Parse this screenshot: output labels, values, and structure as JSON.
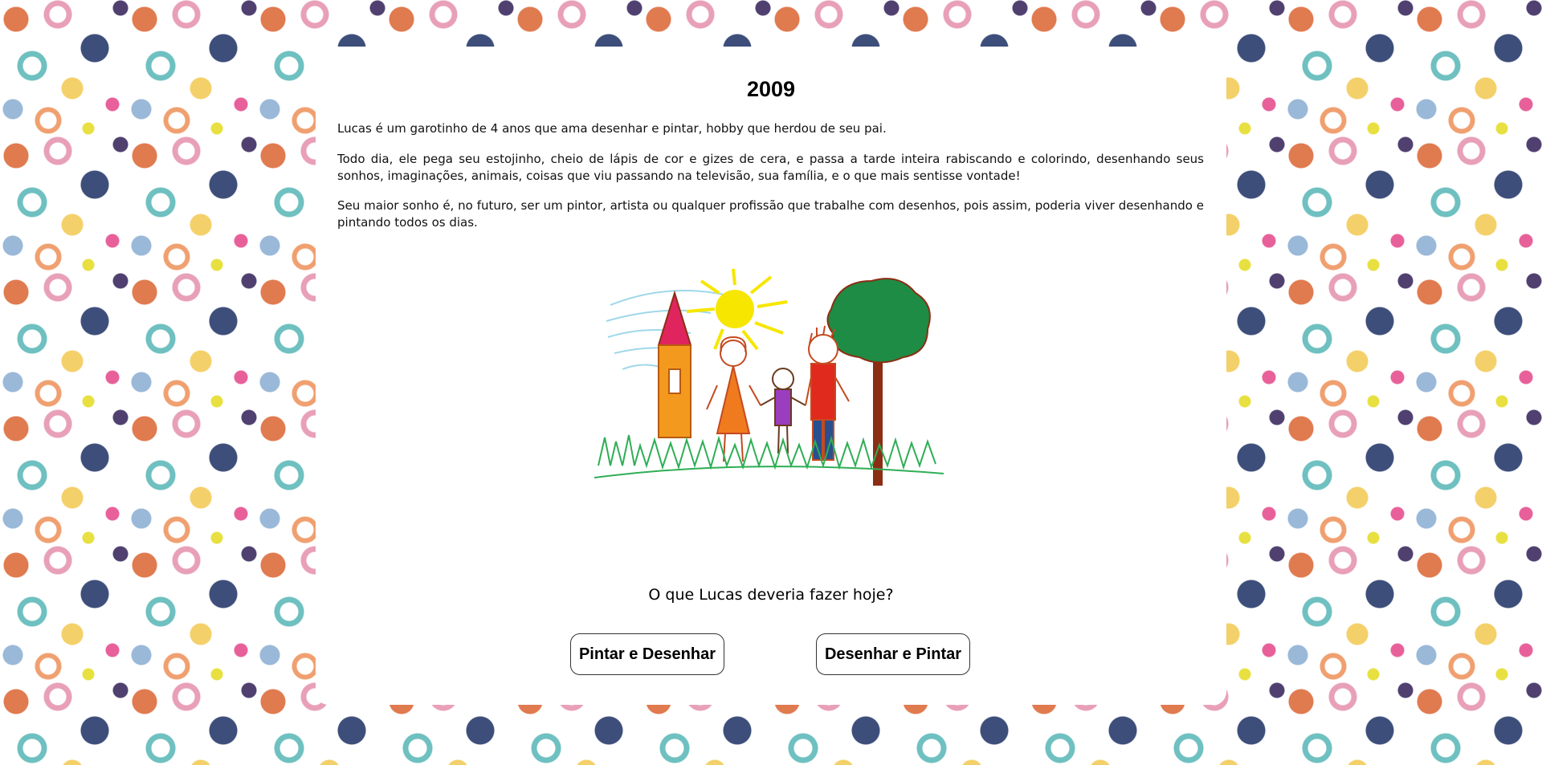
{
  "page": {
    "title": "2009",
    "paragraphs": [
      "Lucas é um garotinho de 4 anos que ama desenhar e pintar, hobby que herdou de seu pai.",
      "Todo dia, ele pega seu estojinho, cheio de lápis de cor e gizes de cera, e passa a tarde inteira rabiscando e colorindo, desenhando seus sonhos, imaginações, animais, coisas que viu passando na televisão, sua família, e o que mais sentisse vontade!",
      "Seu maior sonho é, no futuro, ser um pintor, artista ou qualquer profissão que trabalhe com desenhos, pois assim, poderia viver desenhando e pintando todos os dias."
    ],
    "question": "O que Lucas deveria fazer hoje?",
    "buttons": [
      "Pintar e Desenhar",
      "Desenhar e Pintar"
    ]
  },
  "colors": {
    "card": "#ffffff",
    "sun": "#f6e600",
    "tree_leaves": "#1e8c45",
    "tree_trunk": "#8b2e14",
    "house_roof": "#e0245e",
    "house_wall": "#f39a1e",
    "grass": "#2fae55",
    "sky_lines": "#9fd8e8"
  }
}
